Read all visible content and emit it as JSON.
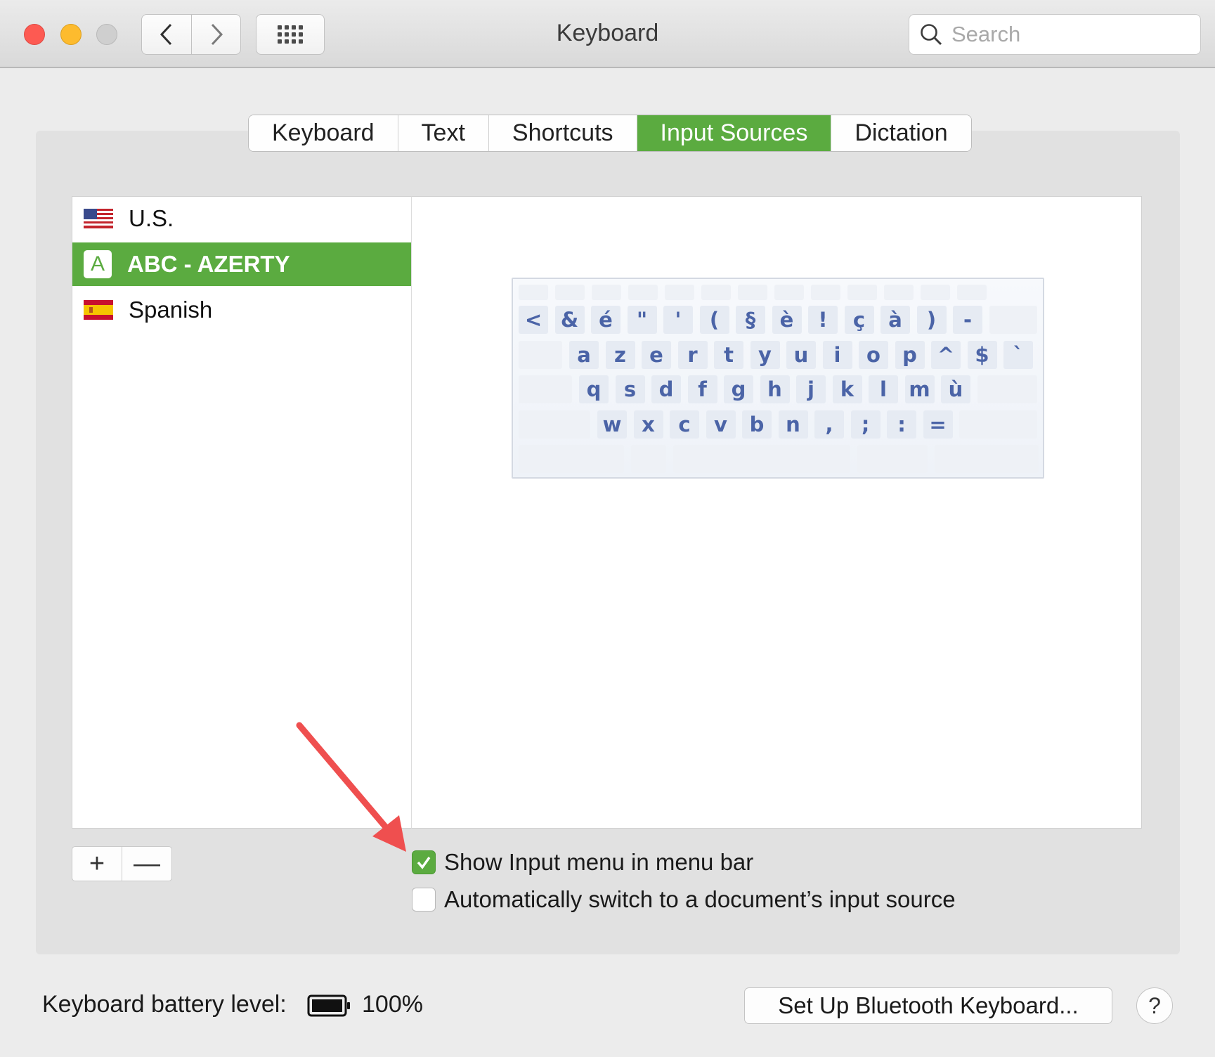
{
  "window": {
    "title": "Keyboard",
    "search_placeholder": "Search"
  },
  "tabs": [
    {
      "label": "Keyboard",
      "active": false
    },
    {
      "label": "Text",
      "active": false
    },
    {
      "label": "Shortcuts",
      "active": false
    },
    {
      "label": "Input Sources",
      "active": true
    },
    {
      "label": "Dictation",
      "active": false
    }
  ],
  "input_sources": [
    {
      "label": "U.S.",
      "icon": "us-flag-icon",
      "selected": false
    },
    {
      "label": "ABC - AZERTY",
      "icon": "letter-a-icon",
      "icon_text": "A",
      "selected": true
    },
    {
      "label": "Spanish",
      "icon": "spain-flag-icon",
      "selected": false
    }
  ],
  "keyboard_layout": {
    "rows": [
      [
        "<",
        "&",
        "é",
        "\"",
        "'",
        "(",
        "§",
        "è",
        "!",
        "ç",
        "à",
        ")",
        "-"
      ],
      [
        "a",
        "z",
        "e",
        "r",
        "t",
        "y",
        "u",
        "i",
        "o",
        "p",
        "^",
        "$",
        "`"
      ],
      [
        "q",
        "s",
        "d",
        "f",
        "g",
        "h",
        "j",
        "k",
        "l",
        "m",
        "ù"
      ],
      [
        "w",
        "x",
        "c",
        "v",
        "b",
        "n",
        ",",
        ";",
        ":",
        "="
      ]
    ]
  },
  "list_controls": {
    "add_label": "+",
    "remove_label": "—"
  },
  "options": {
    "show_input_menu": {
      "label": "Show Input menu in menu bar",
      "checked": true
    },
    "auto_switch": {
      "label": "Automatically switch to a document’s input source",
      "checked": false
    }
  },
  "footer": {
    "battery_label": "Keyboard battery level:",
    "battery_value": "100%",
    "bluetooth_button": "Set Up Bluetooth Keyboard...",
    "help_label": "?"
  },
  "colors": {
    "accent": "#5bab40",
    "annotation_arrow": "#ef4f4f",
    "key_text": "#4b64a7"
  }
}
